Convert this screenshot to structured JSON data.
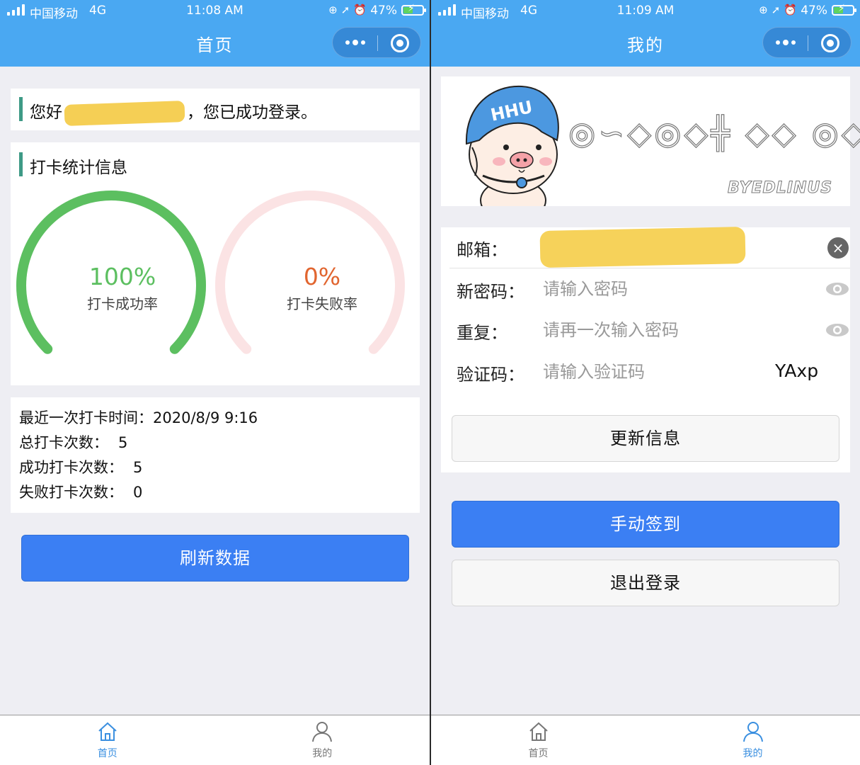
{
  "left": {
    "status": {
      "carrier": "中国移动",
      "network": "4G",
      "time": "11:08 AM",
      "battery": "47%",
      "icons": [
        "rotation-lock-icon",
        "location-icon",
        "alarm-icon"
      ]
    },
    "nav_title": "首页",
    "greeting": {
      "prefix": "您好",
      "masked_visible": "18",
      "masked_tail": "2",
      "suffix": "，您已成功登录。"
    },
    "stats": {
      "title": "打卡统计信息",
      "success": {
        "value": "100%",
        "label": "打卡成功率",
        "fraction": 1.0,
        "color": "#5cbf60",
        "track": "#d8ecd9"
      },
      "fail": {
        "value": "0%",
        "label": "打卡失败率",
        "fraction": 0.0,
        "color": "#e1652f",
        "track": "#fbe3e4"
      }
    },
    "info": [
      {
        "label": "最近一次打卡时间：",
        "value": "2020/8/9 9:16"
      },
      {
        "label": "总打卡次数：",
        "value": "5"
      },
      {
        "label": "成功打卡次数：",
        "value": "5"
      },
      {
        "label": "失败打卡次数：",
        "value": "0"
      }
    ],
    "refresh_label": "刷新数据"
  },
  "right": {
    "status": {
      "carrier": "中国移动",
      "network": "4G",
      "time": "11:09 AM",
      "battery": "47%",
      "icons": [
        "rotation-lock-icon",
        "location-icon",
        "alarm-icon"
      ]
    },
    "nav_title": "我的",
    "banner": {
      "helmet_text": "HHU",
      "signature": "BYEDLINUS"
    },
    "form": {
      "email_label": "邮箱：",
      "password_label": "新密码：",
      "password_placeholder": "请输入密码",
      "repeat_label": "重复：",
      "repeat_placeholder": "请再一次输入密码",
      "code_label": "验证码：",
      "code_placeholder": "请输入验证码",
      "captcha": "YAxp"
    },
    "update_label": "更新信息",
    "checkin_label": "手动签到",
    "logout_label": "退出登录"
  },
  "tabbar": {
    "home": "首页",
    "mine": "我的"
  },
  "colors": {
    "header": "#4aa8f2",
    "primary_button": "#3b7ff3",
    "tab_active": "#3a8fe0",
    "accent_bar": "#3e9a86"
  }
}
